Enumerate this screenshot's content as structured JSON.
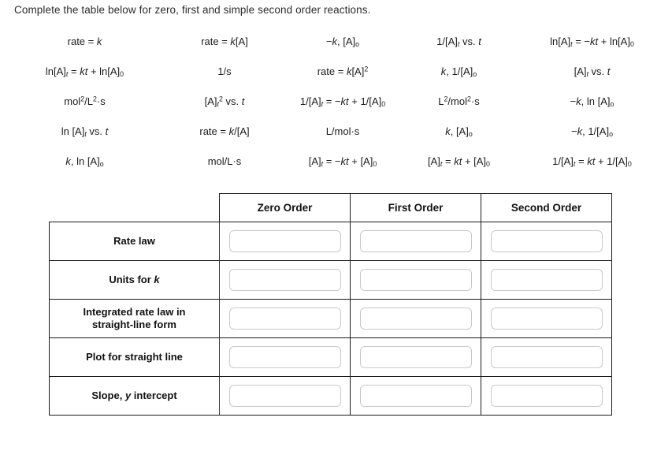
{
  "prompt": "Complete the table below for zero, first and simple second order reactions.",
  "answer_bank": {
    "rows": [
      [
        {
          "id": "rate-eq-k",
          "text": "rate = k"
        },
        {
          "id": "rate-eq-kA",
          "text": "rate = k[A]"
        },
        {
          "id": "neg-k-A0",
          "text": "−k, [A]₀"
        },
        {
          "id": "inv-A-vs-t",
          "text": "1/[A]ₜ vs. t"
        },
        {
          "id": "lnA-eq-negkt-plus-lnA0",
          "text": "ln[A]ₜ = −kt + ln[A]₀"
        }
      ],
      [
        {
          "id": "lnA-eq-kt-plus-lnA0",
          "text": "ln[A]ₜ = kt + ln[A]₀"
        },
        {
          "id": "units-inv-s",
          "text": "1/s"
        },
        {
          "id": "rate-eq-kA-squared",
          "text": "rate = k[A]²"
        },
        {
          "id": "k-inv-A0",
          "text": "k, 1/[A]₀"
        },
        {
          "id": "A-vs-t",
          "text": "[A]ₜ vs. t"
        }
      ],
      [
        {
          "id": "units-mol2-L2-s",
          "text": "mol²/L²·s"
        },
        {
          "id": "A-squared-vs-t",
          "text": "[A]ₜ² vs. t"
        },
        {
          "id": "invA-eq-negkt-plus-invA0",
          "text": "1/[A]ₜ = −kt + 1/[A]₀"
        },
        {
          "id": "units-L2-mol2-s",
          "text": "L²/mol²·s"
        },
        {
          "id": "neg-k-lnA0",
          "text": "−k, ln [A]₀"
        }
      ],
      [
        {
          "id": "lnA-vs-t",
          "text": "ln [A]ₜ vs. t"
        },
        {
          "id": "rate-eq-k-over-A",
          "text": "rate = k/[A]"
        },
        {
          "id": "units-L-mol-s",
          "text": "L/mol·s"
        },
        {
          "id": "k-A0",
          "text": "k, [A]₀"
        },
        {
          "id": "neg-k-inv-A0",
          "text": "−k, 1/[A]₀"
        }
      ],
      [
        {
          "id": "k-lnA0",
          "text": "k, ln [A]₀"
        },
        {
          "id": "units-mol-L-s",
          "text": "mol/L·s"
        },
        {
          "id": "A-eq-negkt-plus-A0",
          "text": "[A]ₜ = −kt + [A]₀"
        },
        {
          "id": "A-eq-kt-plus-A0",
          "text": "[A]ₜ = kt + [A]₀"
        },
        {
          "id": "invA-eq-kt-plus-invA0",
          "text": "1/[A]ₜ = kt + 1/[A]₀"
        }
      ]
    ],
    "rows_html": [
      [
        "rate = <span class=\"it\">k</span>",
        "rate = <span class=\"it\">k</span>[A]",
        "−<span class=\"it\">k</span>, [A]<sub>o</sub>",
        "1/[A]<sub class=\"it\">t</sub> vs. <span class=\"it\">t</span>",
        "ln[A]<sub class=\"it\">t</sub> = −<span class=\"it\">kt</span> + ln[A]<sub>0</sub>"
      ],
      [
        "ln[A]<sub class=\"it\">t</sub> = <span class=\"it\">kt</span> + ln[A]<sub>0</sub>",
        "1/s",
        "rate = <span class=\"it\">k</span>[A]<sup>2</sup>",
        "<span class=\"it\">k</span>, 1/[A]<sub>o</sub>",
        "[A]<sub class=\"it\">t</sub> vs. <span class=\"it\">t</span>"
      ],
      [
        "mol<sup>2</sup>/L<sup>2</sup>·s",
        "[A]<sub class=\"it\">t</sub><sup>2</sup> vs. <span class=\"it\">t</span>",
        "1/[A]<sub class=\"it\">t</sub> = −<span class=\"it\">kt</span> + 1/[A]<sub>0</sub>",
        "L<sup>2</sup>/mol<sup>2</sup>·s",
        "−<span class=\"it\">k</span>, ln [A]<sub>o</sub>"
      ],
      [
        "ln [A]<sub class=\"it\">t</sub> vs. <span class=\"it\">t</span>",
        "rate = <span class=\"it\">k</span>/[A]",
        "L/mol·s",
        "<span class=\"it\">k</span>, [A]<sub>o</sub>",
        "−<span class=\"it\">k</span>, 1/[A]<sub>o</sub>"
      ],
      [
        "<span class=\"it\">k</span>, ln [A]<sub>o</sub>",
        "mol/L·s",
        "[A]<sub class=\"it\">t</sub> = −<span class=\"it\">kt</span> + [A]<sub>0</sub>",
        "[A]<sub class=\"it\">t</sub> = <span class=\"it\">kt</span> + [A]<sub>0</sub>",
        "1/[A]<sub class=\"it\">t</sub> = <span class=\"it\">kt</span> + 1/[A]<sub>0</sub>"
      ]
    ]
  },
  "table": {
    "column_headers": [
      "Zero Order",
      "First Order",
      "Second Order"
    ],
    "row_labels": [
      "Rate law",
      "Units for k",
      "Integrated rate law in straight-line form",
      "Plot for straight line",
      "Slope, y intercept"
    ],
    "row_labels_html": [
      "Rate law",
      "Units for <span class=\"it\">k</span>",
      "Integrated rate law in<br>straight-line form",
      "Plot for straight line",
      "Slope, <span class=\"it\">y</span> intercept"
    ],
    "answers": [
      [
        "",
        "",
        ""
      ],
      [
        "",
        "",
        ""
      ],
      [
        "",
        "",
        ""
      ],
      [
        "",
        "",
        ""
      ],
      [
        "",
        "",
        ""
      ]
    ]
  },
  "colors": {
    "text": "#1a1a1a",
    "table_border": "#1a1a1a",
    "input_border": "#c9c9c9",
    "background": "#ffffff"
  }
}
